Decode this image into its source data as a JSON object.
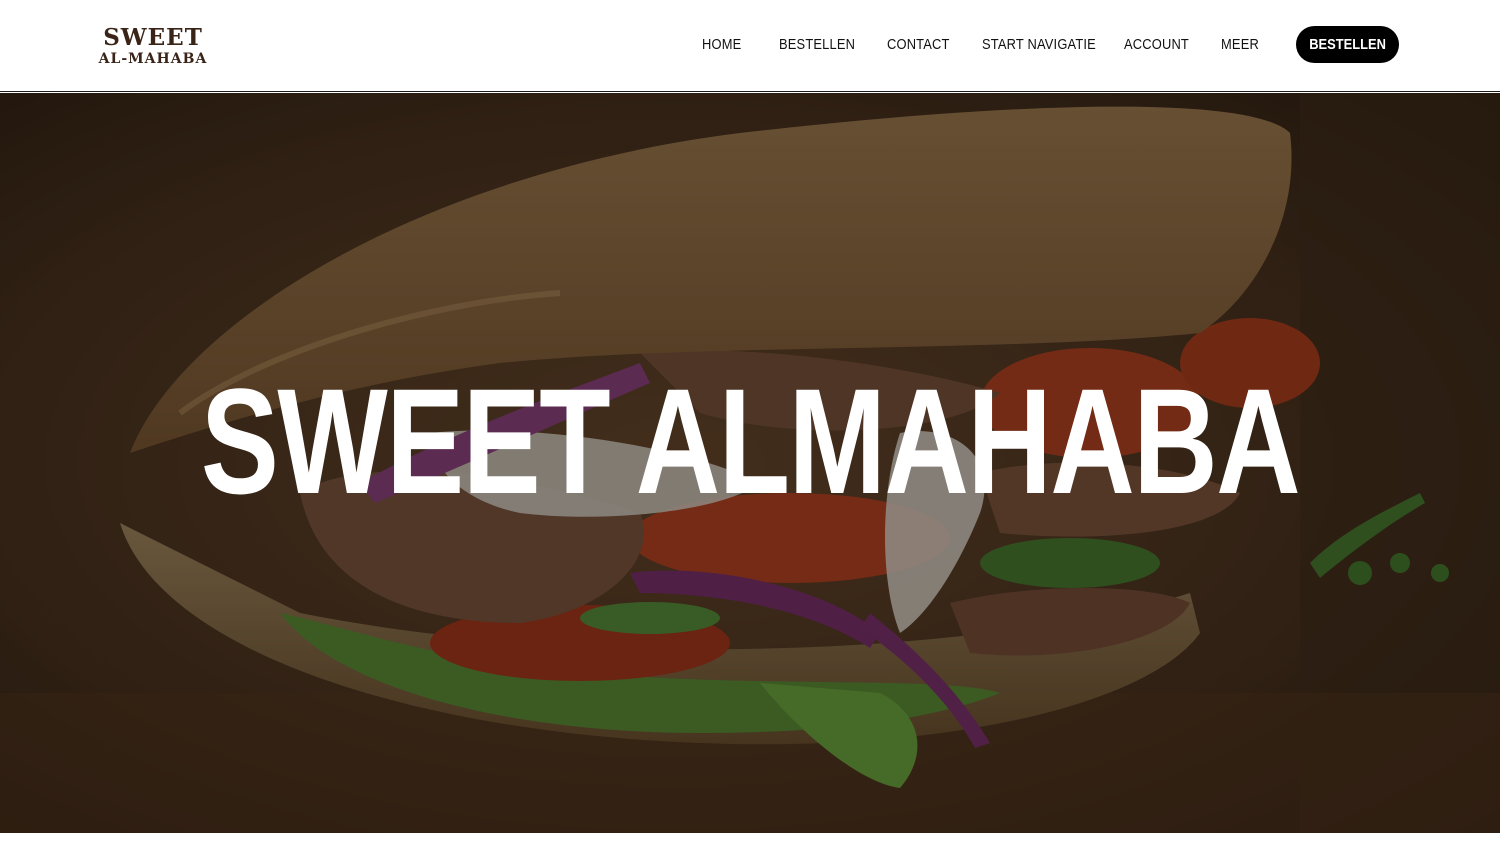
{
  "logo": {
    "line1": "SWEET",
    "line2": "AL-MAHABA"
  },
  "nav": {
    "items": [
      {
        "label": "HOME"
      },
      {
        "label": "BESTELLEN"
      },
      {
        "label": "CONTACT"
      },
      {
        "label": "START NAVIGATIE"
      },
      {
        "label": "ACCOUNT"
      },
      {
        "label": "MEER"
      }
    ],
    "cta_label": "BESTELLEN"
  },
  "hero": {
    "title": "SWEET ALMAHABA",
    "image": "kebab-sandwich-photo"
  },
  "colors": {
    "header_bg": "#ffffff",
    "nav_text": "#111111",
    "cta_bg": "#000000",
    "cta_text": "#ffffff",
    "logo_text": "#3a2418",
    "hero_title": "#ffffff"
  }
}
